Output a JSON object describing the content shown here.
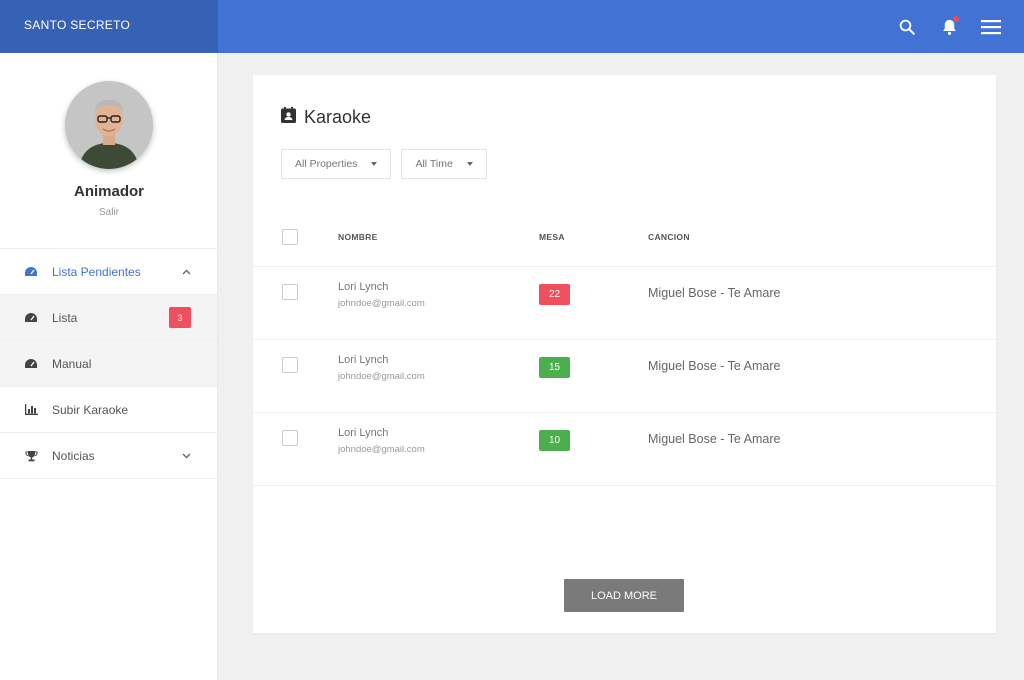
{
  "app": {
    "brand": "SANTO SECRETO"
  },
  "topbar": {
    "icons": [
      "search-icon",
      "bell-icon",
      "menu-icon"
    ],
    "has_notification": true,
    "accent": "#4172d4"
  },
  "profile": {
    "name": "Animador",
    "sub_link": "Salir"
  },
  "sidebar": {
    "items": [
      {
        "label": "Lista Pendientes",
        "icon": "dashboard-icon",
        "active": true,
        "chevron": "up"
      },
      {
        "label": "Lista",
        "icon": "dashboard-icon",
        "badge": "3"
      },
      {
        "label": "Manual",
        "icon": "dashboard-icon"
      },
      {
        "label": "Subir Karaoke",
        "icon": "bar-chart-icon"
      },
      {
        "label": "Noticias",
        "icon": "trophy-icon",
        "chevron": "down"
      }
    ]
  },
  "main": {
    "title": "Karaoke",
    "filters": [
      {
        "label": "All Properties"
      },
      {
        "label": "All Time"
      }
    ],
    "table": {
      "columns": [
        "NOMBRE",
        "MESA",
        "CANCION"
      ],
      "rows": [
        {
          "name": "Lori Lynch",
          "email": "johndoe@gmail.com",
          "mesa": "22",
          "mesa_color": "#f0505e",
          "song": "Miguel Bose - Te Amare"
        },
        {
          "name": "Lori Lynch",
          "email": "johndoe@gmail.com",
          "mesa": "15",
          "mesa_color": "#4cae4c",
          "song": "Miguel Bose - Te Amare"
        },
        {
          "name": "Lori Lynch",
          "email": "johndoe@gmail.com",
          "mesa": "10",
          "mesa_color": "#4cae4c",
          "song": "Miguel Bose - Te Amare"
        }
      ]
    },
    "load_more": "LOAD MORE"
  }
}
